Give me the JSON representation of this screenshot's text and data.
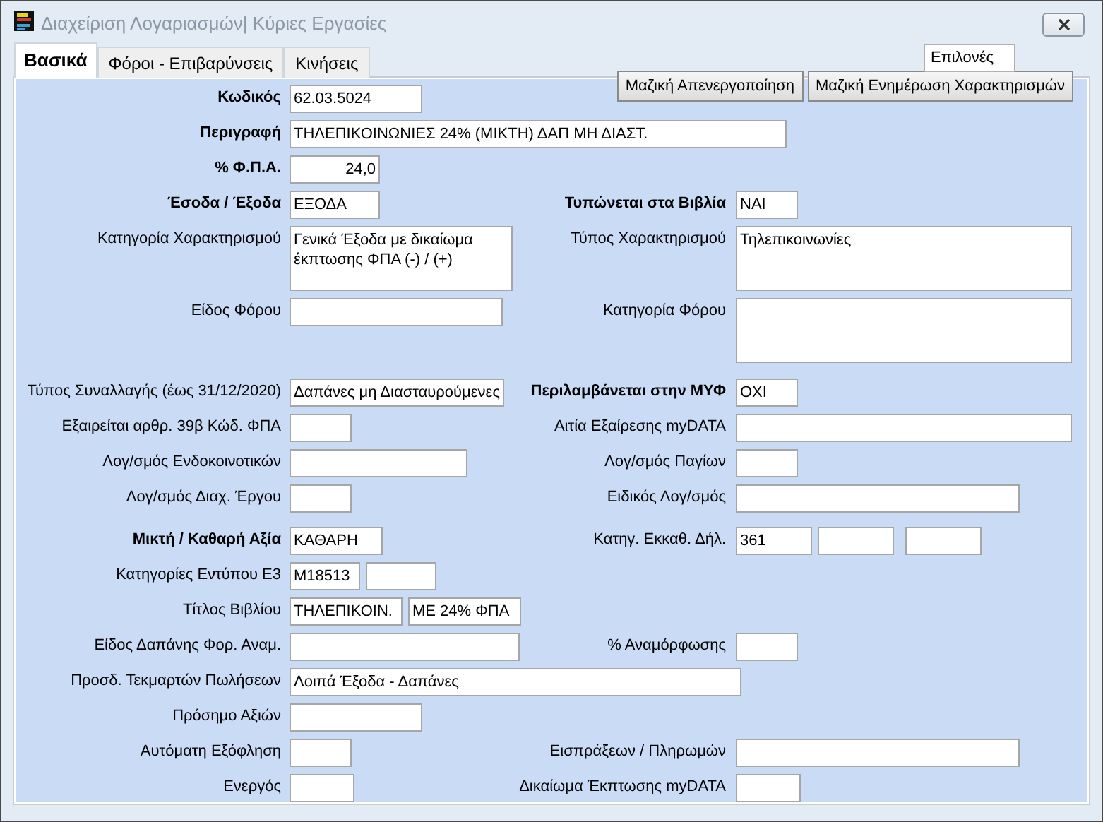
{
  "window": {
    "title": "Διαχείριση Λογαριασμών| Κύριες Εργασίες"
  },
  "tabs": [
    {
      "label": "Βασικά",
      "selected": true
    },
    {
      "label": "Φόροι - Επιβαρύνσεις",
      "selected": false
    },
    {
      "label": "Κινήσεις",
      "selected": false
    }
  ],
  "options_field": {
    "value": "Επιλονές"
  },
  "rows": [
    {
      "left": {
        "label": "Κωδικός",
        "bold": true,
        "fields": [
          {
            "kind": "text",
            "value": "62.03.5024"
          }
        ]
      },
      "right": {
        "buttons": [
          "Μαζική Απενεργοποίηση",
          "Μαζική Ενημέρωση Χαρακτηρισμών"
        ]
      }
    },
    {
      "left": {
        "label": "Περιγραφή",
        "bold": true,
        "fields": [
          {
            "kind": "text",
            "value": "ΤΗΛΕΠΙΚΟΙΝΩΝΙΕΣ 24% (ΜΙΚΤΗ) ΔΑΠ ΜΗ ΔΙΑΣΤ."
          }
        ]
      }
    },
    {
      "left": {
        "label": "% Φ.Π.Α.",
        "bold": true,
        "fields": [
          {
            "kind": "number",
            "value": "24,0"
          }
        ]
      }
    },
    {
      "left": {
        "label": "Έσοδα / Έξοδα",
        "bold": true,
        "fields": [
          {
            "kind": "text",
            "value": "ΕΞΟΔΑ"
          }
        ]
      },
      "right": {
        "label": "Τυπώνεται στα Βιβλία",
        "bold": true,
        "fields": [
          {
            "kind": "text",
            "value": "ΝΑΙ"
          }
        ]
      }
    },
    {
      "left": {
        "label": "Κατηγορία Χαρακτηρισμού",
        "bold": false,
        "fields": [
          {
            "kind": "textarea",
            "value": "Γενικά Έξοδα με δικαίωμα έκπτωσης ΦΠΑ (-) / (+)"
          }
        ]
      },
      "right": {
        "label": "Τύπος Χαρακτηρισμού",
        "bold": false,
        "fields": [
          {
            "kind": "textarea",
            "value": "Τηλεπικοινωνίες"
          }
        ]
      }
    },
    {
      "left": {
        "label": "Είδος Φόρου",
        "bold": false,
        "fields": [
          {
            "kind": "text"
          }
        ]
      },
      "right": {
        "label": "Κατηγορία Φόρου",
        "bold": false,
        "fields": [
          {
            "kind": "textarea"
          }
        ]
      }
    },
    {
      "left": {
        "label": "Τύπος Συναλλαγής (έως 31/12/2020)",
        "bold": false,
        "fields": [
          {
            "kind": "text",
            "value": "Δαπάνες μη Διασταυρούμενες"
          }
        ]
      },
      "right": {
        "label": "Περιλαμβάνεται στην ΜΥΦ",
        "bold": true,
        "fields": [
          {
            "kind": "text",
            "value": "ΟΧΙ"
          }
        ]
      }
    },
    {
      "left": {
        "label": "Εξαιρείται αρθρ. 39β Κώδ. ΦΠΑ",
        "bold": false,
        "fields": [
          {
            "kind": "text"
          }
        ]
      },
      "right": {
        "label": "Αιτία Εξαίρεσης myDATA",
        "bold": false,
        "fields": [
          {
            "kind": "text"
          }
        ]
      }
    },
    {
      "left": {
        "label": "Λογ/σμός Ενδοκοινοτικών",
        "bold": false,
        "fields": [
          {
            "kind": "text"
          }
        ]
      },
      "right": {
        "label": "Λογ/σμός  Παγίων",
        "bold": false,
        "fields": [
          {
            "kind": "text"
          }
        ]
      }
    },
    {
      "left": {
        "label": "Λογ/σμός Διαχ. Έργου",
        "bold": false,
        "fields": [
          {
            "kind": "text"
          }
        ]
      },
      "right": {
        "label": "Ειδικός Λογ/σμός",
        "bold": false,
        "fields": [
          {
            "kind": "text"
          }
        ]
      }
    },
    {
      "left": {
        "label": "Μικτή  / Καθαρή Αξία",
        "bold": true,
        "fields": [
          {
            "kind": "text",
            "value": "ΚΑΘΑΡΗ"
          }
        ]
      },
      "right": {
        "label": "Κατηγ. Εκκαθ. Δήλ.",
        "bold": false,
        "fields": [
          {
            "kind": "text",
            "value": "361"
          },
          {
            "kind": "text"
          },
          {
            "kind": "text"
          }
        ]
      }
    },
    {
      "left": {
        "label": "Κατηγορίες Εντύπου Ε3",
        "bold": false,
        "fields": [
          {
            "kind": "text",
            "value": "Μ18513"
          },
          {
            "kind": "text"
          }
        ]
      }
    },
    {
      "left": {
        "label": "Τίτλος Βιβλίου",
        "bold": false,
        "fields": [
          {
            "kind": "text",
            "value": "ΤΗΛΕΠΙΚΟΙΝ."
          },
          {
            "kind": "text",
            "value": "ΜΕ 24% ΦΠΑ"
          }
        ]
      }
    },
    {
      "left": {
        "label": "Είδος Δαπάνης Φορ. Αναμ.",
        "bold": false,
        "fields": [
          {
            "kind": "text"
          }
        ]
      },
      "right": {
        "label": "% Αναμόρφωσης",
        "bold": false,
        "fields": [
          {
            "kind": "text"
          }
        ]
      }
    },
    {
      "left": {
        "label": "Προσδ. Τεκμαρτών Πωλήσεων",
        "bold": false,
        "fields": [
          {
            "kind": "text",
            "value": "Λοιπά Έξοδα - Δαπάνες"
          }
        ]
      }
    },
    {
      "left": {
        "label": "Πρόσημο Αξιών",
        "bold": false,
        "fields": [
          {
            "kind": "text"
          }
        ]
      }
    },
    {
      "left": {
        "label": "Αυτόματη Εξόφληση",
        "bold": false,
        "fields": [
          {
            "kind": "text"
          }
        ]
      },
      "right": {
        "label": "Εισπράξεων / Πληρωμών",
        "bold": false,
        "fields": [
          {
            "kind": "text"
          }
        ]
      }
    },
    {
      "left": {
        "label": "Ενεργός",
        "bold": false,
        "fields": [
          {
            "kind": "text"
          }
        ]
      },
      "right": {
        "label": "Δικαίωμα Έκπτωσης myDATA",
        "bold": false,
        "fields": [
          {
            "kind": "text"
          }
        ]
      }
    }
  ]
}
